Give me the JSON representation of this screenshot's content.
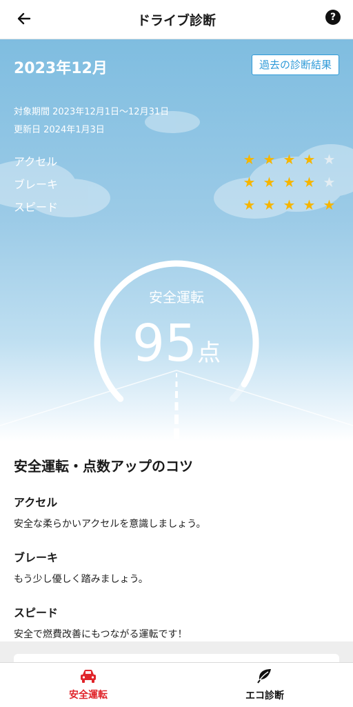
{
  "header": {
    "title": "ドライブ診断",
    "back_icon": "arrow-left-icon",
    "help_label": "?"
  },
  "summary": {
    "month": "2023年12月",
    "history_button": "過去の診断結果",
    "period": "対象期間 2023年12月1日〜12月31日",
    "updated": "更新日 2024年1月3日"
  },
  "ratings": [
    {
      "label": "アクセル",
      "stars": 4,
      "max": 5
    },
    {
      "label": "ブレーキ",
      "stars": 4,
      "max": 5
    },
    {
      "label": "スピード",
      "stars": 5,
      "max": 5
    }
  ],
  "score": {
    "title": "安全運転",
    "value": "95",
    "unit": "点",
    "gauge_fraction": 0.95
  },
  "tips": {
    "heading": "安全運転・点数アップのコツ",
    "items": [
      {
        "title": "アクセル",
        "text": "安全な柔らかいアクセルを意識しましょう。"
      },
      {
        "title": "ブレーキ",
        "text": "もう少し優しく踏みましょう。"
      },
      {
        "title": "スピード",
        "text": "安全で燃費改善にもつながる運転です！"
      }
    ]
  },
  "tabs": [
    {
      "label": "安全運転",
      "icon": "car-icon",
      "active": true
    },
    {
      "label": "エコ診断",
      "icon": "leaf-icon",
      "active": false
    }
  ],
  "colors": {
    "accent": "#e0242a",
    "link": "#2e9ad8",
    "star_on": "#f5b500",
    "sky_top": "#7fbde0"
  }
}
